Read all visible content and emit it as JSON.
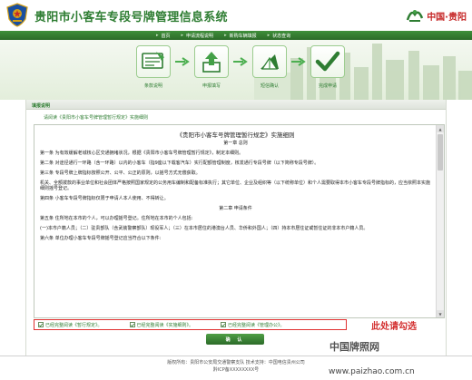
{
  "header": {
    "title": "贵阳市小客车专段号牌管理信息系统",
    "brand": "中国·贵阳",
    "police_emblem_icon": "police-emblem-icon",
    "brand_icon": "guiyang-logo-icon"
  },
  "nav": {
    "items": [
      "首页",
      "申请流程说明",
      "新购车辆填报",
      "状态查询"
    ]
  },
  "steps": [
    {
      "label": "条款说明",
      "icon": "document-scan-icon"
    },
    {
      "label": "申报填写",
      "icon": "upload-arrow-icon"
    },
    {
      "label": "短信确认",
      "icon": "paper-plane-icon"
    },
    {
      "label": "完成申请",
      "icon": "checkmark-icon"
    }
  ],
  "main": {
    "section_title": "填报说明",
    "subtitle_link": "请阅读《贵阳市小客车号牌管理暂行规定》实施细则",
    "doc": {
      "title": "《贵阳市小客车号牌管理暂行规定》实施细则",
      "chapter1": "第一章  总则",
      "paragraphs": [
        "第一条  为有效缓解老城核心区交通拥堵状况，根据《贵阳市小客车号牌管理暂行规定》，制定本细则。",
        "第二条  对途径通行一环路（含一环路）以内的小客车（指9座以下载客汽车）实行配额管理制度，核发通行专段号牌（以下简称专段号牌）。",
        "第三条  专段号牌上牌指标按照公开、公平、公正的原则，以摇号方式无偿获取。",
        "机关、全额拨款的事业单位和社会团体严格按照国家规定的公务用车编制和配备标准执行；其它单位、企业及组织等（以下统称单位）和个人需要取得本市小客车专段号牌指标的，应当依照本实施细则摇号登记。",
        "第四条  小客车专段号牌指标仅限于申请人本人使用、不得转让。"
      ],
      "chapter2": "第二章    申请条件",
      "paragraphs2": [
        "第五条    住所地在本市的个人，可以办理摇号登记。住所地在本市的个人包括:",
        "(一)本市户籍人员；（二）驻贵部队（含武装警察部队）现役军人；（三）在本市居住的港澳台人员、华侨和外国人；（四）持本市居住证或暂住证的非本市户籍人员。",
        "第六条    单位办理小客车专段号牌摇号登记应当符合以下条件:"
      ]
    },
    "agreements": [
      "已经完整阅读《暂行规定》。",
      "已经完整阅读《实施细则》。",
      "已经完整阅读《管理办公》。"
    ],
    "hint": "此处请勾选",
    "confirm_label": "确 认"
  },
  "footer": {
    "line1": "版权所有：贵阳市公安局交通警察支队   技术支持：中国电信贵州公司",
    "line2": "黔ICP备XXXXXXXX号"
  },
  "watermark": {
    "line1": "中国牌照网",
    "line2": "www.paizhao.com.cn"
  },
  "colors": {
    "primary_green": "#2e7d32",
    "nav_green": "#3f8f3a",
    "hint_red": "#d32f2f",
    "border_red": "#e03030"
  }
}
